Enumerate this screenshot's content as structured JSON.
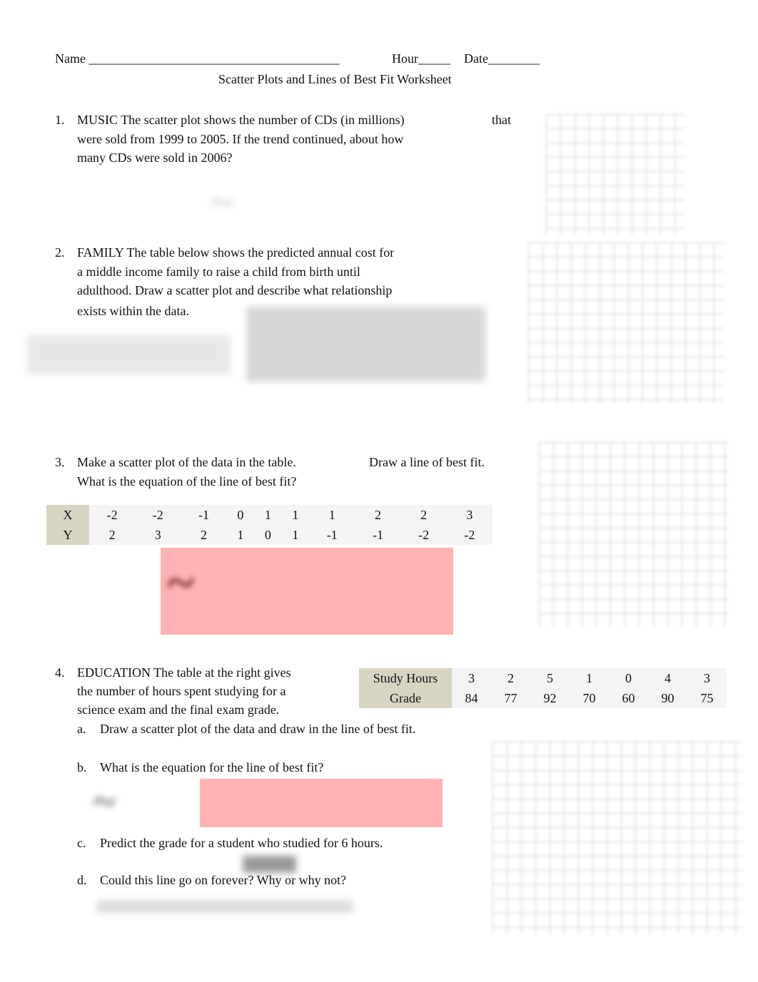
{
  "header": {
    "name_label": "Name _______________________________________",
    "hour_label": "Hour_____",
    "date_label": "Date________",
    "title": "Scatter Plots and Lines of Best Fit Worksheet"
  },
  "q1": {
    "num": "1.",
    "line1": "MUSIC    The scatter plot shows the number of CDs (in millions)",
    "line1b": "that",
    "line2": "were sold from 1999 to 2005.          If the trend continued, about how",
    "line3": "many CDs were sold in 2006?"
  },
  "q2": {
    "num": "2.",
    "line1": "FAMILY    The table below shows the predicted annual cost for",
    "line2": "a middle income family to raise a child from birth until",
    "line3": "adulthood.     Draw a scatter plot and describe what relationship",
    "line4": "exists within the data."
  },
  "q3": {
    "num": "3.",
    "line1": "Make a scatter plot of the data in the table.",
    "line1b": "Draw a line of best fit.",
    "line2": "What is the equation of the line of best fit?",
    "table": {
      "x_label": "X",
      "y_label": "Y",
      "x": [
        "-2",
        "-2",
        "-1",
        "0",
        "1",
        "1",
        "1",
        "2",
        "2",
        "3"
      ],
      "y": [
        "2",
        "3",
        "2",
        "1",
        "0",
        "1",
        "-1",
        "-1",
        "-2",
        "-2"
      ]
    }
  },
  "q4": {
    "num": "4.",
    "line1": "EDUCATION    The table at the right gives",
    "line2": "the number of hours spent studying for a",
    "line3": "science exam and the final exam grade.",
    "a": "a.",
    "a_text": "Draw a scatter plot of the data and draw in the line of best fit.",
    "b": "b.",
    "b_text": "What is the equation for the line of best fit?",
    "c": "c.",
    "c_text": "Predict the grade for a student who studied for 6 hours.",
    "d": "d.",
    "d_text": "Could this line go on forever?        Why or why not?",
    "table": {
      "hours_label": "Study Hours",
      "grade_label": "Grade",
      "hours": [
        "3",
        "2",
        "5",
        "1",
        "0",
        "4",
        "3"
      ],
      "grades": [
        "84",
        "77",
        "92",
        "70",
        "60",
        "90",
        "75"
      ]
    }
  },
  "colors": {
    "answer_highlight": "#ffb3b3",
    "table_header": "#d8d4c2"
  }
}
